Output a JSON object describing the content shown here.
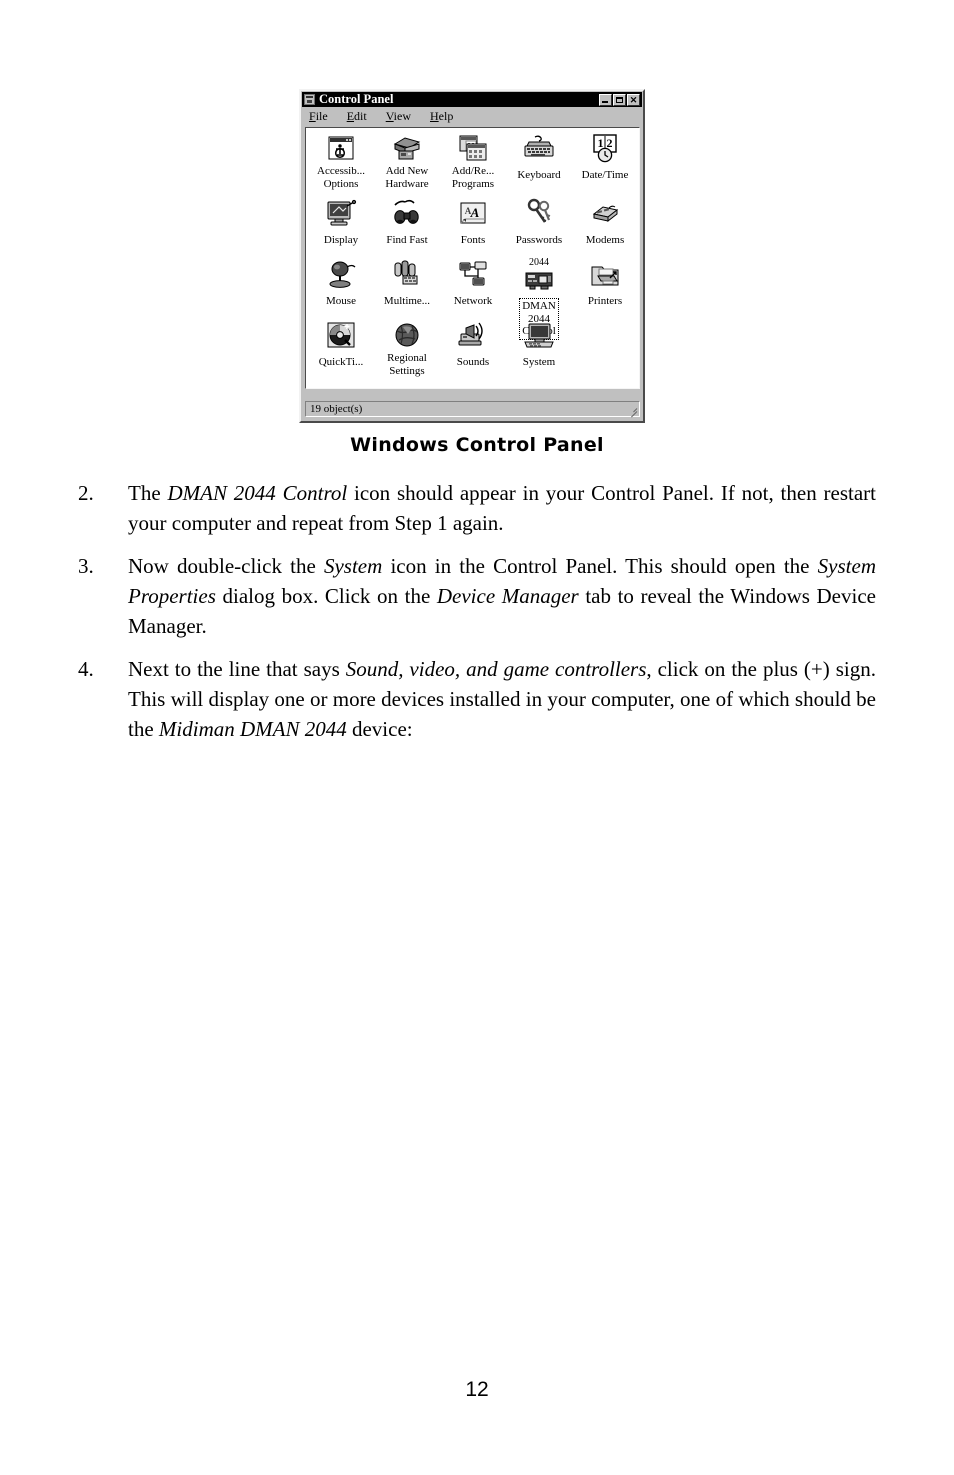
{
  "window": {
    "title": "Control Panel",
    "title_icon": "control-panel-icon",
    "buttons": {
      "minimize": "_",
      "maximize": "□",
      "close": "✕"
    },
    "menu": [
      {
        "label": "File",
        "accel": "F",
        "rest": "ile"
      },
      {
        "label": "Edit",
        "accel": "E",
        "rest": "dit"
      },
      {
        "label": "View",
        "accel": "V",
        "rest": "iew"
      },
      {
        "label": "Help",
        "accel": "H",
        "rest": "elp"
      }
    ],
    "status": "19 object(s)",
    "icons": [
      {
        "label": "Accessib...\nOptions",
        "icon": "accessibility-options-icon",
        "selected": false,
        "toplabel": ""
      },
      {
        "label": "Add New\nHardware",
        "icon": "add-new-hardware-icon",
        "selected": false,
        "toplabel": ""
      },
      {
        "label": "Add/Re...\nPrograms",
        "icon": "add-remove-programs-icon",
        "selected": false,
        "toplabel": ""
      },
      {
        "label": "Keyboard",
        "icon": "keyboard-icon",
        "selected": false,
        "toplabel": ""
      },
      {
        "label": "Date/Time",
        "icon": "date-time-icon",
        "selected": false,
        "toplabel": ""
      },
      {
        "label": "Display",
        "icon": "display-icon",
        "selected": false,
        "toplabel": ""
      },
      {
        "label": "Find Fast",
        "icon": "find-fast-icon",
        "selected": false,
        "toplabel": ""
      },
      {
        "label": "Fonts",
        "icon": "fonts-icon",
        "selected": false,
        "toplabel": ""
      },
      {
        "label": "Passwords",
        "icon": "passwords-icon",
        "selected": false,
        "toplabel": ""
      },
      {
        "label": "Modems",
        "icon": "modems-icon",
        "selected": false,
        "toplabel": ""
      },
      {
        "label": "Mouse",
        "icon": "mouse-icon",
        "selected": false,
        "toplabel": ""
      },
      {
        "label": "Multime...",
        "icon": "multimedia-icon",
        "selected": false,
        "toplabel": ""
      },
      {
        "label": "Network",
        "icon": "network-icon",
        "selected": false,
        "toplabel": ""
      },
      {
        "label": "DMAN\n2044\nControl",
        "icon": "dman-2044-control-icon",
        "selected": true,
        "toplabel": "2044"
      },
      {
        "label": "Printers",
        "icon": "printers-icon",
        "selected": false,
        "toplabel": ""
      },
      {
        "label": "QuickTi...",
        "icon": "quicktime-icon",
        "selected": false,
        "toplabel": ""
      },
      {
        "label": "Regional\nSettings",
        "icon": "regional-settings-icon",
        "selected": false,
        "toplabel": ""
      },
      {
        "label": "Sounds",
        "icon": "sounds-icon",
        "selected": false,
        "toplabel": ""
      },
      {
        "label": "System",
        "icon": "system-icon",
        "selected": false,
        "toplabel": ""
      }
    ]
  },
  "caption": "Windows Control Panel",
  "steps": [
    {
      "number": "2.",
      "html": "The <i>DMAN 2044 Control</i> icon should appear in your Control Panel.  If not, then restart your computer and repeat from Step 1 again."
    },
    {
      "number": "3.",
      "html": "Now double-click the <i>System</i> icon in the Control Panel.  This should open the <i>System Properties</i> dialog box.  Click on the <i>Device Manager</i> tab to reveal the Windows Device Manager."
    },
    {
      "number": "4.",
      "html": "Next to the line that says <i>Sound, video, and game controllers</i>, click on the plus (+) sign.  This will display one or more devices installed in your computer, one of which should be the <i>Midiman DMAN 2044</i> device:"
    }
  ],
  "page_number": "12"
}
